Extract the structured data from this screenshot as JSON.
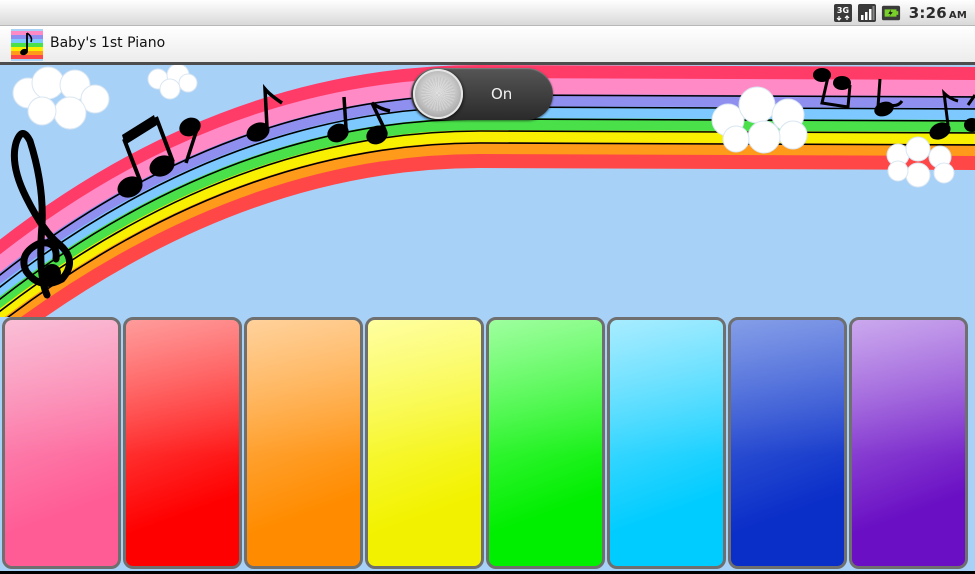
{
  "status_bar": {
    "network_icon": "3g-icon",
    "signal_icon": "signal-strength-icon",
    "battery_icon": "battery-charging-icon",
    "time": "3:26",
    "ampm": "AM"
  },
  "app": {
    "icon": "app-rainbow-icon",
    "title": "Baby's 1st Piano"
  },
  "toggle": {
    "label": "On",
    "state": "on"
  },
  "keys": [
    {
      "name": "key-pink",
      "color_top": "#f8a9c8",
      "color_bottom": "#ff5c95"
    },
    {
      "name": "key-red",
      "color_top": "#ff7a7a",
      "color_bottom": "#ff0000"
    },
    {
      "name": "key-orange",
      "color_top": "#ffc27a",
      "color_bottom": "#ff8c00"
    },
    {
      "name": "key-yellow",
      "color_top": "#ffff80",
      "color_bottom": "#f2f200"
    },
    {
      "name": "key-green",
      "color_top": "#7dff7d",
      "color_bottom": "#00ee00"
    },
    {
      "name": "key-cyan",
      "color_top": "#8ae6ff",
      "color_bottom": "#00ccff"
    },
    {
      "name": "key-blue",
      "color_top": "#5b7de0",
      "color_bottom": "#0a2ec8"
    },
    {
      "name": "key-purple",
      "color_top": "#b98be8",
      "color_bottom": "#6a0fc4"
    }
  ],
  "colors": {
    "sky": "#a8d1f7",
    "rainbow": [
      "#ff3b68",
      "#ff8ac6",
      "#8f8ff0",
      "#7cc8ff",
      "#49e04a",
      "#f8f000",
      "#ff9a1a",
      "#ff4747"
    ]
  }
}
